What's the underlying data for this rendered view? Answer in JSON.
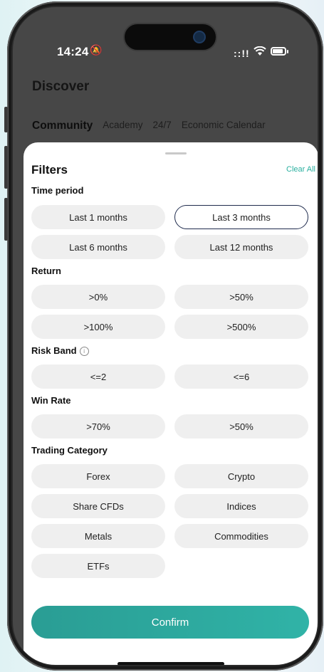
{
  "status_bar": {
    "time": "14:24",
    "bell_off_icon": "🔕",
    "signal": "::!!",
    "wifi_icon": "wifi-icon",
    "battery_icon": "battery-icon"
  },
  "page": {
    "title": "Discover"
  },
  "tabs": [
    {
      "label": "Community",
      "active": true
    },
    {
      "label": "Academy",
      "active": false
    },
    {
      "label": "24/7",
      "active": false
    },
    {
      "label": "Economic Calendar",
      "active": false
    }
  ],
  "sheet": {
    "title": "Filters",
    "clear_all": "Clear All",
    "sections": {
      "time_period": {
        "label": "Time period",
        "options": [
          "Last 1 months",
          "Last 3 months",
          "Last 6 months",
          "Last 12 months"
        ],
        "selected": "Last 3 months"
      },
      "return": {
        "label": "Return",
        "options": [
          ">0%",
          ">50%",
          ">100%",
          ">500%"
        ]
      },
      "risk_band": {
        "label": "Risk Band",
        "info_icon": "ⓘ",
        "options": [
          "<=2",
          "<=6"
        ]
      },
      "win_rate": {
        "label": "Win Rate",
        "options": [
          ">70%",
          ">50%"
        ]
      },
      "trading_category": {
        "label": "Trading Category",
        "options": [
          "Forex",
          "Crypto",
          "Share CFDs",
          "Indices",
          "Metals",
          "Commodities",
          "ETFs"
        ]
      }
    },
    "confirm": "Confirm"
  },
  "colors": {
    "accent": "#2bb0a0",
    "confirm_bg": "#2a9d94",
    "selected_border": "#1f2b4d",
    "chip_bg": "#efefef",
    "backdrop": "#474747"
  }
}
